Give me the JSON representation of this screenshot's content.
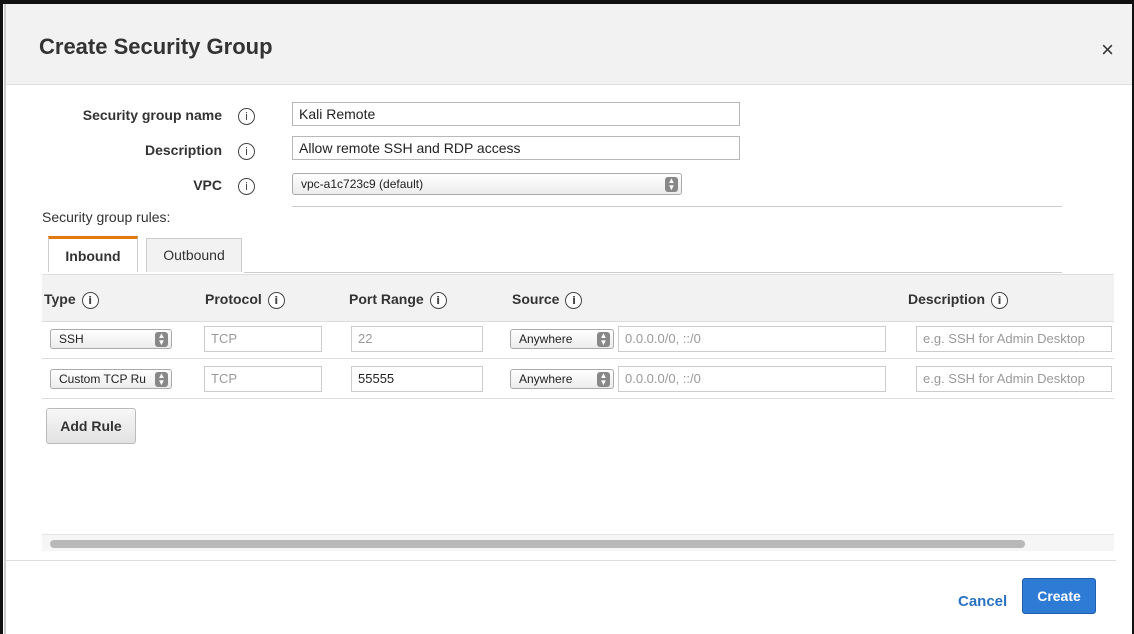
{
  "dialog": {
    "title": "Create Security Group",
    "close_symbol": "×"
  },
  "form": {
    "name_label": "Security group name",
    "name_value": "Kali Remote",
    "description_label": "Description",
    "description_value": "Allow remote SSH and RDP access",
    "vpc_label": "VPC",
    "vpc_value": "vpc-a1c723c9 (default)",
    "info_glyph": "i"
  },
  "rules": {
    "section_label": "Security group rules:",
    "tabs": [
      {
        "label": "Inbound",
        "active": true
      },
      {
        "label": "Outbound",
        "active": false
      }
    ],
    "columns": [
      "Type",
      "Protocol",
      "Port Range",
      "Source",
      "Description"
    ],
    "rows": [
      {
        "type": "SSH",
        "protocol": "TCP",
        "port_range": "22",
        "source_mode": "Anywhere",
        "source_value": "0.0.0.0/0, ::/0",
        "description_placeholder": "e.g. SSH for Admin Desktop"
      },
      {
        "type": "Custom TCP Ru",
        "protocol": "TCP",
        "port_range": "55555",
        "source_mode": "Anywhere",
        "source_value": "0.0.0.0/0, ::/0",
        "description_placeholder": "e.g. SSH for Admin Desktop"
      }
    ],
    "add_rule_label": "Add Rule"
  },
  "footer": {
    "cancel_label": "Cancel",
    "create_label": "Create"
  },
  "colors": {
    "tab_accent": "#e47911",
    "primary_button": "#2e7bd6",
    "link": "#2a73c4"
  },
  "icons": {
    "info": "info-icon",
    "close": "close-icon",
    "select_arrow": "updown-arrow-icon"
  }
}
